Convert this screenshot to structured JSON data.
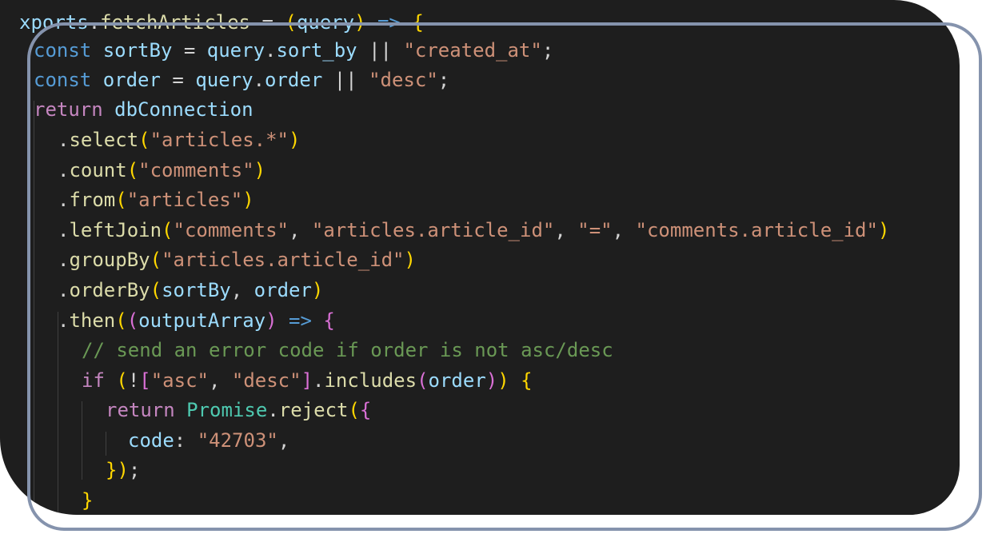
{
  "editor": {
    "language": "javascript",
    "theme_background": "#1e1e1e",
    "frame_color": "#8593ad",
    "lines": [
      "xports.fetchArticles = (query) => {",
      "const sortBy = query.sort_by || \"created_at\";",
      "const order = query.order || \"desc\";",
      "return dbConnection",
      ".select(\"articles.*\")",
      ".count(\"comments\")",
      ".from(\"articles\")",
      ".leftJoin(\"comments\", \"articles.article_id\", \"=\", \"comments.article_id\")",
      ".groupBy(\"articles.article_id\")",
      ".orderBy(sortBy, order)",
      ".then((outputArray) => {",
      "// send an error code if order is not asc/desc",
      "if (![\"asc\", \"desc\"].includes(order)) {",
      "return Promise.reject({",
      "code: \"42703\",",
      "});",
      "}"
    ]
  }
}
